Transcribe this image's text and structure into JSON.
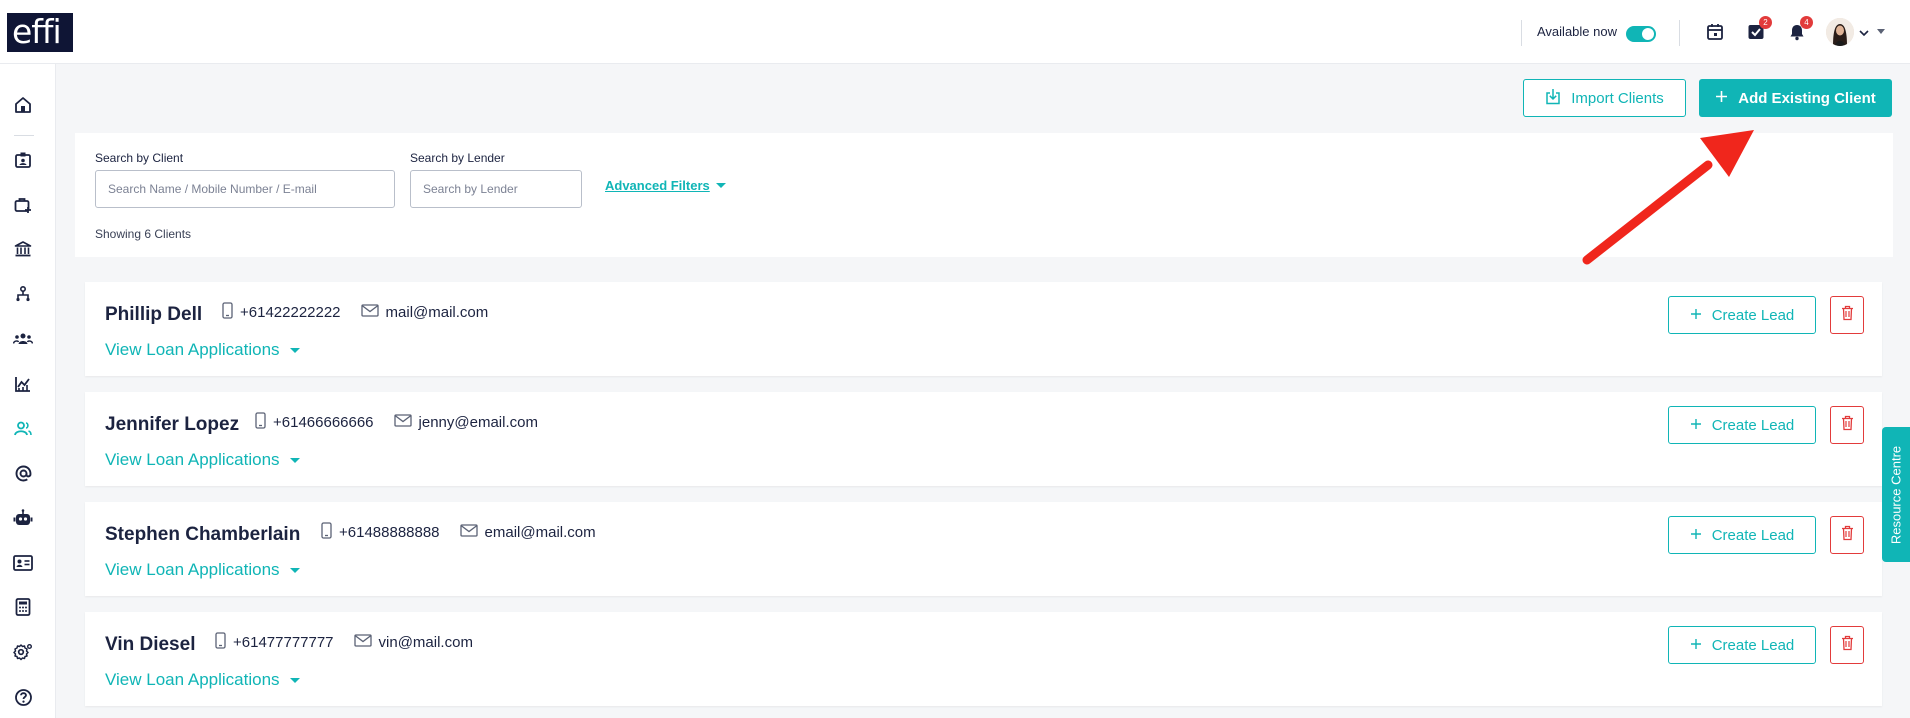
{
  "header": {
    "logo": "effi",
    "availability_label": "Available now",
    "availability_on": true,
    "tasks_badge": "2",
    "notifications_badge": "4"
  },
  "sidebar": {
    "items": [
      {
        "icon": "home-icon"
      },
      {
        "icon": "id-badge-icon"
      },
      {
        "icon": "briefcase-plus-icon"
      },
      {
        "icon": "bank-icon"
      },
      {
        "icon": "org-chart-icon"
      },
      {
        "icon": "team-icon"
      },
      {
        "icon": "analytics-icon"
      },
      {
        "icon": "clients-icon",
        "active": true
      },
      {
        "icon": "at-sign-icon"
      },
      {
        "icon": "robot-icon"
      },
      {
        "icon": "contact-card-icon"
      },
      {
        "icon": "calculator-icon"
      },
      {
        "icon": "settings-gear-icon"
      },
      {
        "icon": "help-icon"
      }
    ]
  },
  "actions": {
    "import_label": "Import Clients",
    "add_label": "Add Existing Client"
  },
  "filters": {
    "client_label": "Search by Client",
    "client_placeholder": "Search Name / Mobile Number / E-mail",
    "lender_label": "Search by Lender",
    "lender_placeholder": "Search by Lender",
    "advanced_label": "Advanced Filters",
    "showing_text": "Showing 6 Clients"
  },
  "clients": [
    {
      "name": "Phillip Dell",
      "phone": "+61422222222",
      "email": "mail@mail.com"
    },
    {
      "name": "Jennifer Lopez",
      "phone": "+61466666666",
      "email": "jenny@email.com"
    },
    {
      "name": "Stephen Chamberlain",
      "phone": "+61488888888",
      "email": "email@mail.com"
    },
    {
      "name": "Vin Diesel",
      "phone": "+61477777777",
      "email": "vin@mail.com"
    }
  ],
  "card_labels": {
    "view_loans": "View Loan Applications",
    "create_lead": "Create Lead"
  },
  "resource_centre": "Resource Centre",
  "colors": {
    "accent": "#10b5b6",
    "danger": "#e23b3b",
    "annotation_arrow": "#f0261c",
    "logo_bg": "#0f1535"
  }
}
